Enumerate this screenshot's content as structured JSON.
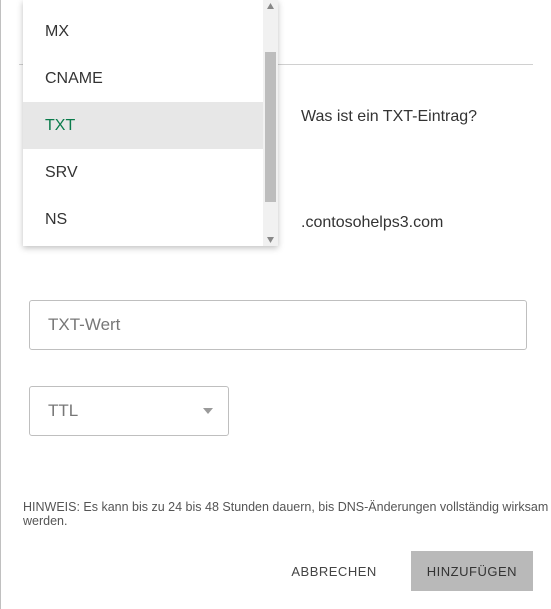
{
  "dropdown": {
    "options": [
      {
        "key": "mx",
        "label": "MX",
        "selected": false
      },
      {
        "key": "cname",
        "label": "CNAME",
        "selected": false
      },
      {
        "key": "txt",
        "label": "TXT",
        "selected": true
      },
      {
        "key": "srv",
        "label": "SRV",
        "selected": false
      },
      {
        "key": "ns",
        "label": "NS",
        "selected": false
      }
    ]
  },
  "info_link": "Was ist ein TXT-Eintrag?",
  "domain_suffix": ".contosohelps3.com",
  "txt_value": {
    "placeholder": "TXT-Wert",
    "value": ""
  },
  "ttl": {
    "placeholder": "TTL"
  },
  "note": "HINWEIS: Es kann bis zu 24 bis 48 Stunden dauern, bis DNS-Änderungen vollständig wirksam werden.",
  "buttons": {
    "cancel": "ABBRECHEN",
    "add": "HINZUFÜGEN"
  }
}
